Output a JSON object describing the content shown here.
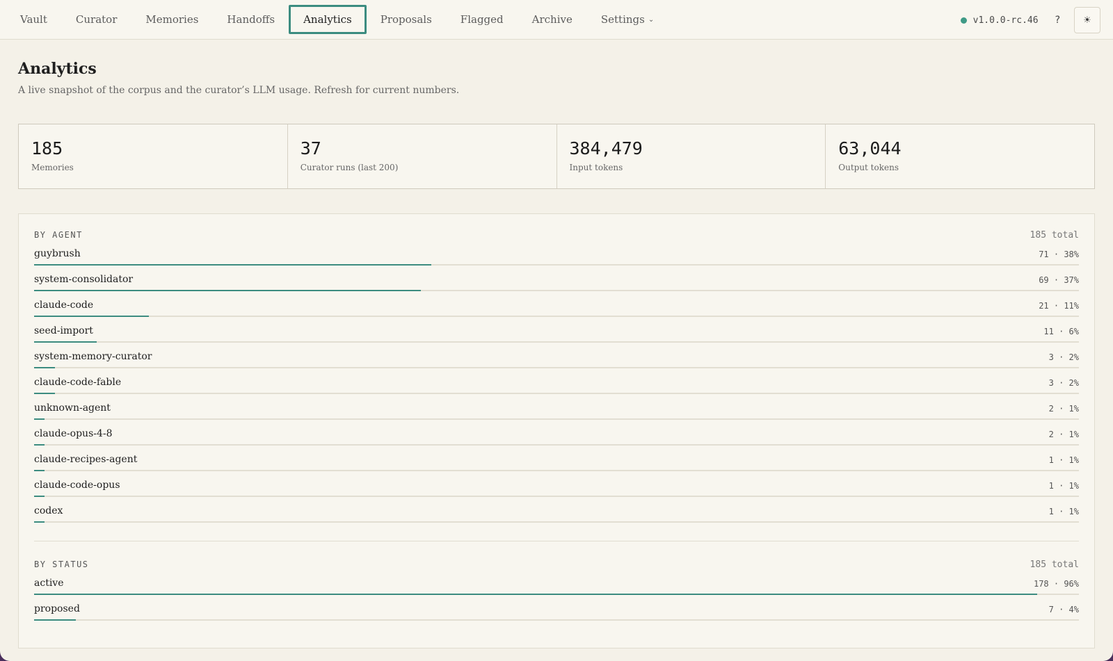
{
  "nav": {
    "tabs": [
      {
        "label": "Vault"
      },
      {
        "label": "Curator"
      },
      {
        "label": "Memories"
      },
      {
        "label": "Handoffs"
      },
      {
        "label": "Analytics",
        "active": true
      },
      {
        "label": "Proposals"
      },
      {
        "label": "Flagged"
      },
      {
        "label": "Archive"
      },
      {
        "label": "Settings",
        "dropdown": true
      }
    ],
    "version": "v1.0.0-rc.46",
    "help": "?",
    "theme_icon": "☀",
    "status_color": "#3f9a86"
  },
  "header": {
    "title": "Analytics",
    "subtitle": "A live snapshot of the corpus and the curator’s LLM usage. Refresh for current numbers."
  },
  "stats": [
    {
      "value": "185",
      "label": "Memories"
    },
    {
      "value": "37",
      "label": "Curator runs (last 200)"
    },
    {
      "value": "384,479",
      "label": "Input tokens"
    },
    {
      "value": "63,044",
      "label": "Output tokens"
    }
  ],
  "by_agent": {
    "title": "BY AGENT",
    "total": "185 total",
    "rows": [
      {
        "name": "guybrush",
        "stat": "71 · 38%",
        "fraction": 0.38
      },
      {
        "name": "system-consolidator",
        "stat": "69 · 37%",
        "fraction": 0.37
      },
      {
        "name": "claude-code",
        "stat": "21 · 11%",
        "fraction": 0.11
      },
      {
        "name": "seed-import",
        "stat": "11 · 6%",
        "fraction": 0.06
      },
      {
        "name": "system-memory-curator",
        "stat": "3 · 2%",
        "fraction": 0.02
      },
      {
        "name": "claude-code-fable",
        "stat": "3 · 2%",
        "fraction": 0.02
      },
      {
        "name": "unknown-agent",
        "stat": "2 · 1%",
        "fraction": 0.01
      },
      {
        "name": "claude-opus-4-8",
        "stat": "2 · 1%",
        "fraction": 0.01
      },
      {
        "name": "claude-recipes-agent",
        "stat": "1 · 1%",
        "fraction": 0.01
      },
      {
        "name": "claude-code-opus",
        "stat": "1 · 1%",
        "fraction": 0.01
      },
      {
        "name": "codex",
        "stat": "1 · 1%",
        "fraction": 0.01
      }
    ]
  },
  "by_status": {
    "title": "BY STATUS",
    "total": "185 total",
    "rows": [
      {
        "name": "active",
        "stat": "178 · 96%",
        "fraction": 0.96
      },
      {
        "name": "proposed",
        "stat": "7 · 4%",
        "fraction": 0.04
      }
    ]
  }
}
